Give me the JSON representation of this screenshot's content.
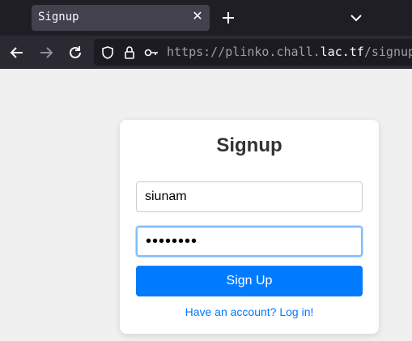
{
  "browser": {
    "tab_title": "Signup",
    "url_prefix": "https://plinko.chall.",
    "url_domain": "lac.tf",
    "url_path": "/signup"
  },
  "icons": {
    "tab_close": "close-icon",
    "new_tab": "plus-icon",
    "tab_list": "chevron-down-icon",
    "back": "arrow-left-icon",
    "forward": "arrow-right-icon",
    "reload": "reload-icon",
    "shield": "shield-icon",
    "lock": "lock-icon",
    "key": "key-icon"
  },
  "form": {
    "title": "Signup",
    "username_value": "siunam",
    "password_value": "••••••••",
    "submit_label": "Sign Up",
    "login_link": "Have an account? Log in!"
  },
  "colors": {
    "accent": "#007bff",
    "page_background": "#f0f0f0",
    "card_background": "#ffffff",
    "focus_border": "#80bdff"
  }
}
